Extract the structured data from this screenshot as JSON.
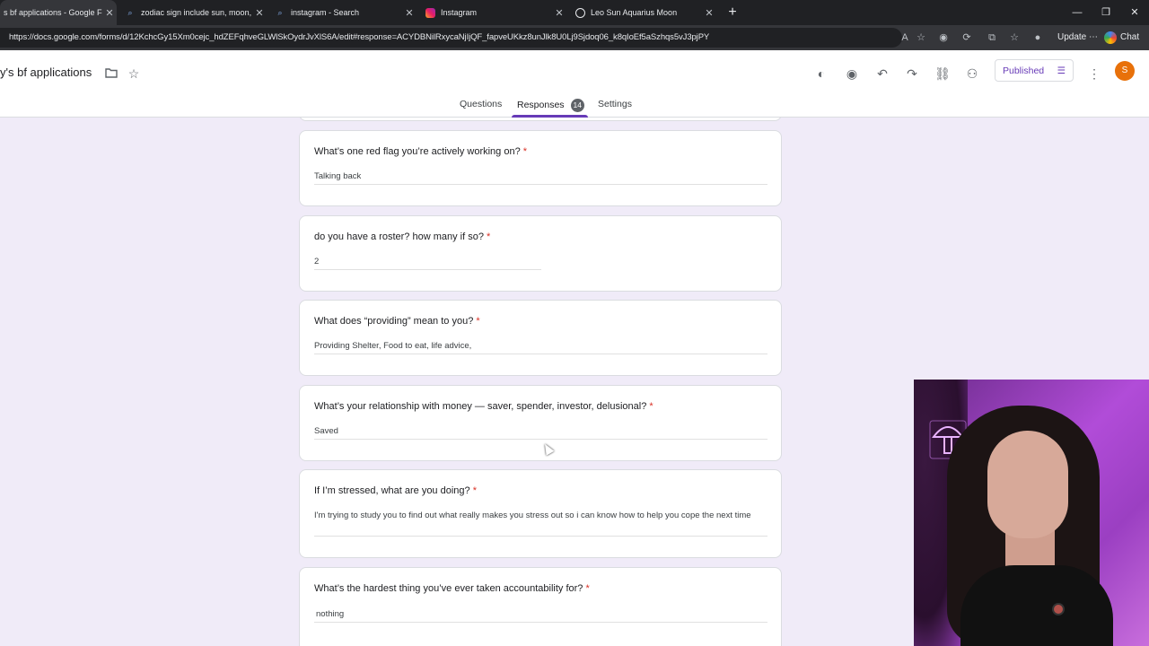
{
  "browser": {
    "tabs": [
      {
        "title": "s bf applications - Google Form",
        "active": true,
        "icon": "google-forms-icon"
      },
      {
        "title": "zodiac sign include sun, moon, AN",
        "active": false,
        "icon": "search-icon"
      },
      {
        "title": "instagram - Search",
        "active": false,
        "icon": "search-icon"
      },
      {
        "title": "Instagram",
        "active": false,
        "icon": "instagram-icon"
      },
      {
        "title": "Leo Sun Aquarius Moon",
        "active": false,
        "icon": "chatgpt-icon"
      }
    ],
    "url": "https://docs.google.com/forms/d/12KchcGy15Xm0cejc_hdZEFqhveGLWlSkOydrJvXlS6A/edit#response=ACYDBNilRxycaNjIjQF_fapveUKkz8unJlk8U0Lj9Sjdoq06_k8qIoEf5aSzhqs5vJ3pjPY",
    "update_label": "Update",
    "chat_label": "Chat"
  },
  "form": {
    "title": "y's bf applications",
    "published_label": "Published",
    "avatar_letter": "S",
    "tabs": {
      "questions": "Questions",
      "responses": "Responses",
      "responses_count": "14",
      "settings": "Settings"
    }
  },
  "questions": [
    {
      "question": "What’s one red flag you’re actively working on?",
      "required": "*",
      "answer": "Talking back"
    },
    {
      "question": "do you have a roster? how many if so?",
      "required": "*",
      "answer": "2"
    },
    {
      "question": "What does “providing” mean to you?",
      "required": "*",
      "answer": "Providing Shelter, Food to eat, life advice,"
    },
    {
      "question": "What’s your relationship with money — saver, spender, investor, delusional?",
      "required": "*",
      "answer": "Saved"
    },
    {
      "question": "If I’m stressed, what are you doing?",
      "required": "*",
      "answer": "I'm trying to study you to find out what really makes you stress out so i can know how to help you cope the next time"
    },
    {
      "question": "What’s the hardest thing you’ve ever taken accountability for?",
      "required": "*",
      "answer": "nothing"
    }
  ]
}
